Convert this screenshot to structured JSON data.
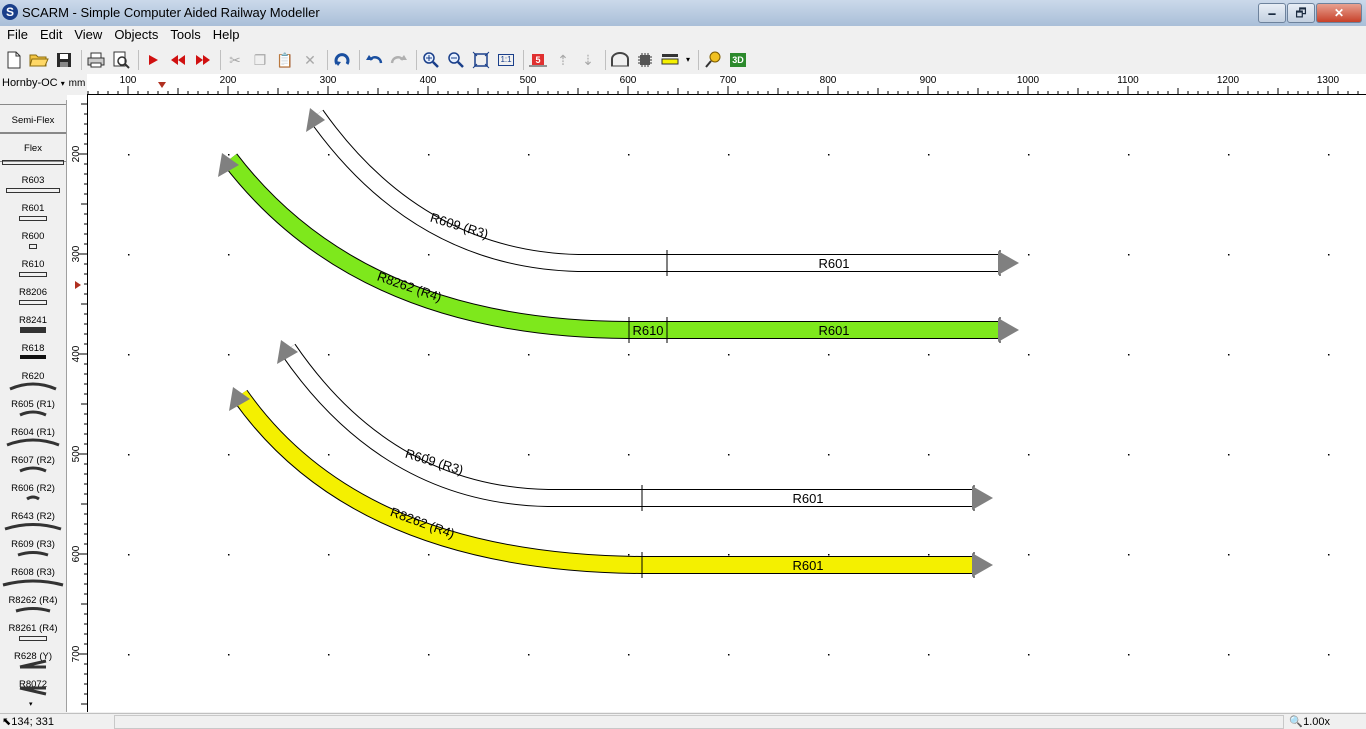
{
  "window": {
    "title": "SCARM - Simple Computer Aided Railway Modeller",
    "icon": "S",
    "minimize": "🗕",
    "maximize": "🗗",
    "close": "✕"
  },
  "menu": [
    "File",
    "Edit",
    "View",
    "Objects",
    "Tools",
    "Help"
  ],
  "toolbar": {
    "icons": [
      "new-file-icon",
      "open-folder-icon",
      "save-icon",
      "print-icon",
      "print-preview-icon",
      "select-arrow-icon",
      "rewind-icon",
      "forward-icon",
      "cut-icon",
      "copy-icon",
      "paste-icon",
      "delete-icon",
      "rotate-icon",
      "undo-icon",
      "redo-icon",
      "zoom-in-icon",
      "zoom-out-icon",
      "zoom-fit-icon",
      "zoom-1-1-icon",
      "flex-track-icon",
      "layer-up-icon",
      "layer-down-icon",
      "tunnel-icon",
      "chip-icon",
      "color-fill-icon",
      "dropdown-icon",
      "measure-icon",
      "view-3d-icon"
    ],
    "zoom_1_1_label": "1:1",
    "view_3d_label": "3D"
  },
  "library": {
    "selected": "Hornby-OC",
    "items": [
      "Semi-Flex",
      "Flex",
      "R603",
      "R601",
      "R600",
      "R610",
      "R8206",
      "R8241",
      "R618",
      "R620",
      "R605 (R1)",
      "R604 (R1)",
      "R607 (R2)",
      "R606 (R2)",
      "R643 (R2)",
      "R609 (R3)",
      "R608 (R3)",
      "R8262 (R4)",
      "R8261 (R4)",
      "R628 (Y)",
      "R8072"
    ]
  },
  "ruler": {
    "unit": "mm",
    "h_labels": [
      "100",
      "200",
      "300",
      "400",
      "500",
      "600",
      "700",
      "800",
      "900",
      "1000",
      "1100",
      "1200",
      "1300"
    ],
    "v_labels": [
      "200",
      "300",
      "400",
      "500",
      "600",
      "700"
    ]
  },
  "tracks": {
    "t1_curve": "R609 (R3)",
    "t1_straight": "R601",
    "t2_curve": "R8262 (R4)",
    "t2_short": "R610",
    "t2_straight": "R601",
    "t3_curve": "R609 (R3)",
    "t3_straight": "R601",
    "t4_curve": "R8262 (R4)",
    "t4_straight": "R601"
  },
  "colors": {
    "green": "#7ee81c",
    "yellow": "#f4f000",
    "white": "#ffffff",
    "arrow": "#808080"
  },
  "status": {
    "coords": "134; 331",
    "zoom": "1.00x"
  }
}
